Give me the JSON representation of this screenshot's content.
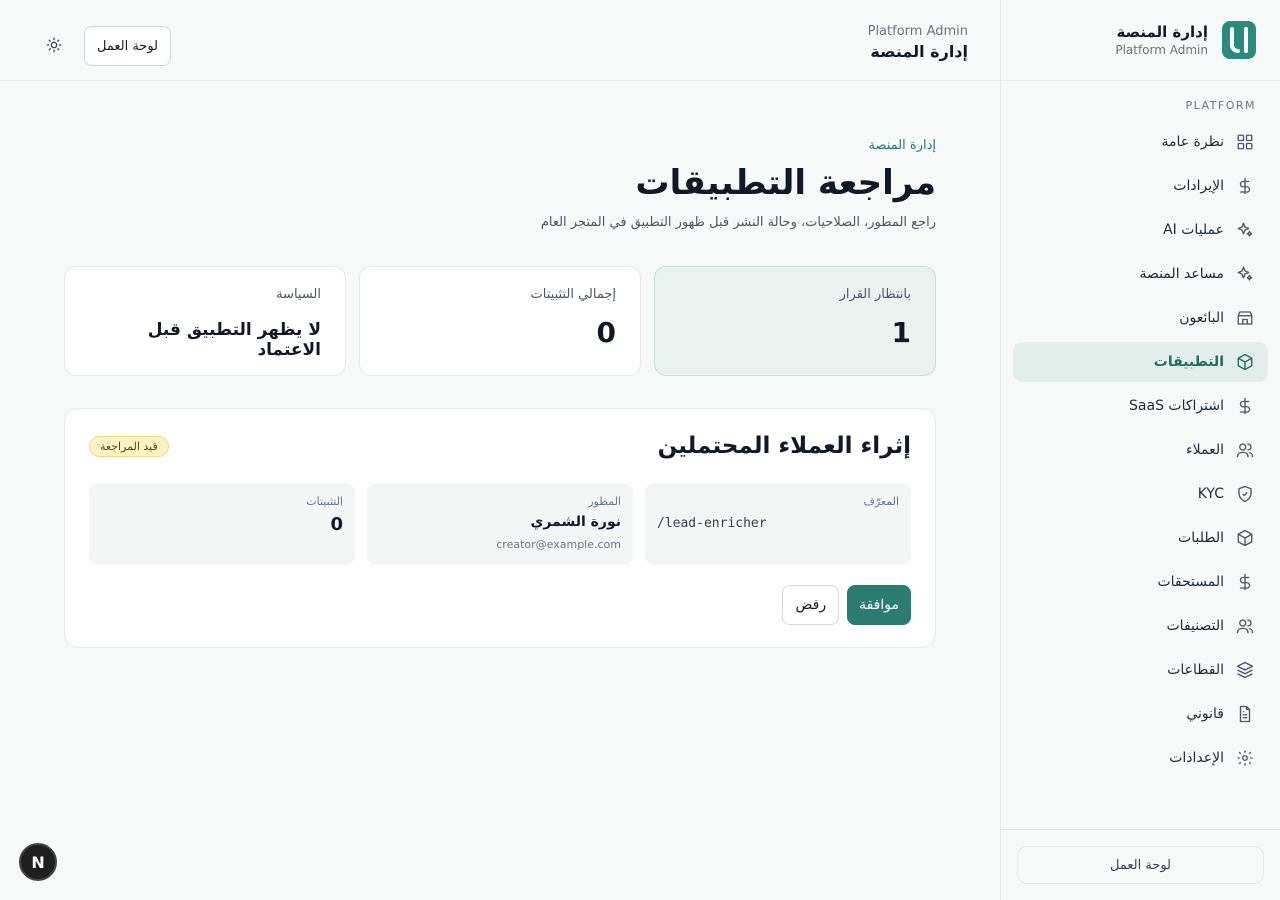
{
  "brand": {
    "title": "إدارة المنصة",
    "subtitle": "Platform Admin",
    "logo_text": "لا"
  },
  "sidebar": {
    "section_label": "PLATFORM",
    "items": [
      {
        "label": "نظرة عامة",
        "icon": "grid-icon"
      },
      {
        "label": "الإيرادات",
        "icon": "dollar-icon"
      },
      {
        "label": "عمليات AI",
        "icon": "sparkles-icon"
      },
      {
        "label": "مساعد المنصة",
        "icon": "sparkles-icon"
      },
      {
        "label": "البائعون",
        "icon": "store-icon"
      },
      {
        "label": "التطبيقات",
        "icon": "box-icon",
        "active": true
      },
      {
        "label": "اشتراكات SaaS",
        "icon": "dollar-icon"
      },
      {
        "label": "العملاء",
        "icon": "users-icon"
      },
      {
        "label": "KYC",
        "icon": "shield-icon"
      },
      {
        "label": "الطلبات",
        "icon": "box-icon"
      },
      {
        "label": "المستحقات",
        "icon": "dollar-icon"
      },
      {
        "label": "التصنيفات",
        "icon": "users-icon"
      },
      {
        "label": "القطاعات",
        "icon": "layers-icon"
      },
      {
        "label": "قانوني",
        "icon": "file-icon"
      },
      {
        "label": "الإعدادات",
        "icon": "gear-icon"
      }
    ],
    "footer_button": "لوحة العمل"
  },
  "topbar": {
    "subtitle": "Platform Admin",
    "title": "إدارة المنصة",
    "workspace_button": "لوحة العمل"
  },
  "main": {
    "breadcrumb": "إدارة المنصة",
    "title": "مراجعة التطبيقات",
    "description": "راجع المطور، الصلاحيات، وحالة النشر قبل ظهور التطبيق في المتجر العام",
    "stats": [
      {
        "label": "بانتظار القرار",
        "value": "1"
      },
      {
        "label": "إجمالي التثبيتات",
        "value": "0"
      },
      {
        "label": "السياسة",
        "value": "لا يظهر التطبيق قبل الاعتماد"
      }
    ],
    "app": {
      "name": "إثراء العملاء المحتملين",
      "status": "قيد المراجعة",
      "identifier_label": "المعرّف",
      "identifier": "/lead-enricher",
      "developer_label": "المطور",
      "developer_name": "نورة الشمري",
      "developer_email": "creator@example.com",
      "installs_label": "التثبيتات",
      "installs": "0",
      "approve_label": "موافقة",
      "reject_label": "رفض"
    }
  },
  "overlay": {
    "next_badge": "N"
  },
  "colors": {
    "accent": "#2a7d70",
    "active_bg": "#e3eeeb",
    "badge_bg": "#fdf3c7"
  }
}
